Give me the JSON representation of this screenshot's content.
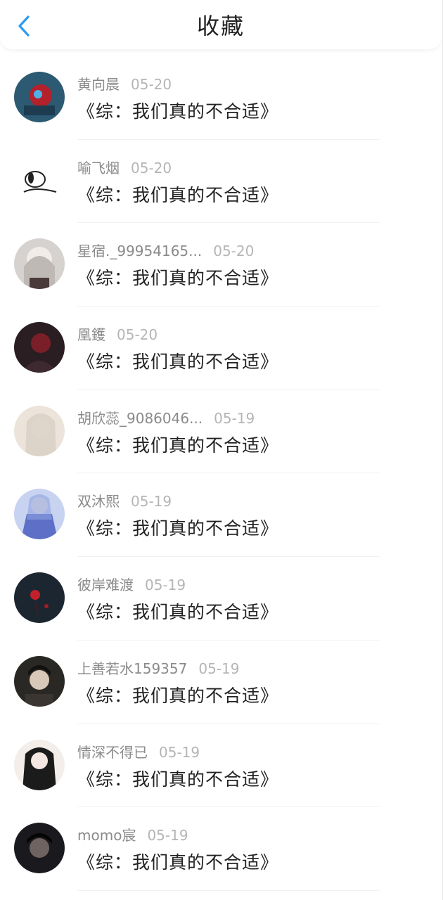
{
  "header": {
    "title": "收藏",
    "back_icon": "chevron-left-icon",
    "accent_color": "#2b9af3"
  },
  "favorites": [
    {
      "username": "黄向晨",
      "date": "05-20",
      "title": "《综：我们真的不合适》",
      "avatar_color": "#2c5a72"
    },
    {
      "username": "喻飞烟",
      "date": "05-20",
      "title": "《综：我们真的不合适》",
      "avatar_color": "#ffffff"
    },
    {
      "username": "星宿._99954165...",
      "date": "05-20",
      "title": "《综：我们真的不合适》",
      "avatar_color": "#d6d2cf"
    },
    {
      "username": "凰鑊",
      "date": "05-20",
      "title": "《综：我们真的不合适》",
      "avatar_color": "#2a1e22"
    },
    {
      "username": "胡欣蕊_9086046...",
      "date": "05-19",
      "title": "《综：我们真的不合适》",
      "avatar_color": "#ece4da"
    },
    {
      "username": "双沐熙",
      "date": "05-19",
      "title": "《综：我们真的不合适》",
      "avatar_color": "#c7d3f0"
    },
    {
      "username": "彼岸难渡",
      "date": "05-19",
      "title": "《综：我们真的不合适》",
      "avatar_color": "#1c2630"
    },
    {
      "username": "上善若水159357",
      "date": "05-19",
      "title": "《综：我们真的不合适》",
      "avatar_color": "#2a2824"
    },
    {
      "username": "情深不得已",
      "date": "05-19",
      "title": "《综：我们真的不合适》",
      "avatar_color": "#f3eeea"
    },
    {
      "username": "momo宸",
      "date": "05-19",
      "title": "《综：我们真的不合适》",
      "avatar_color": "#1a1a1e"
    }
  ]
}
